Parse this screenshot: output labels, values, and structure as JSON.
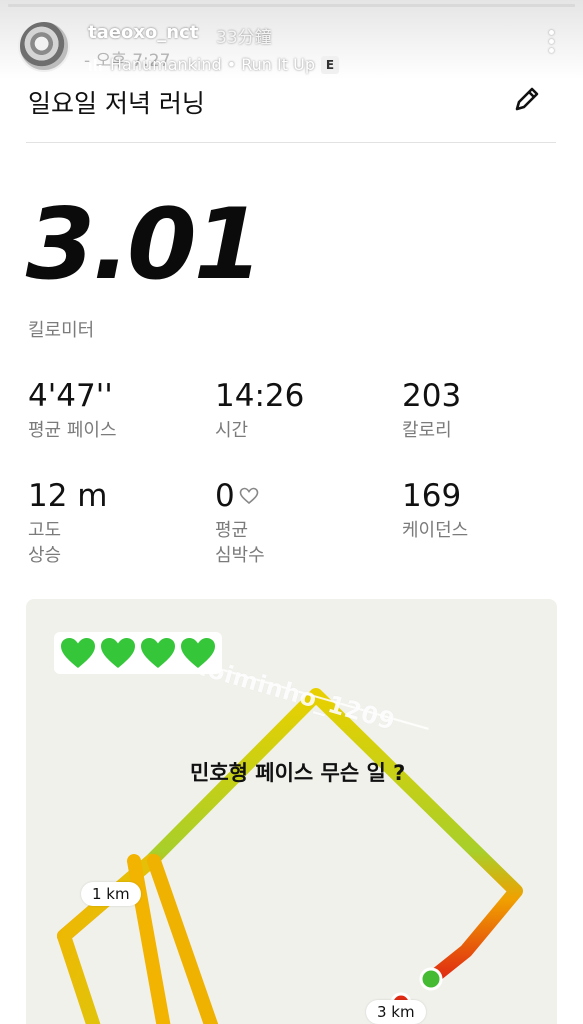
{
  "story": {
    "username": "taeoxo_nct",
    "time_ago": "33分鐘",
    "music": "Hanumankind • Run It Up",
    "explicit_badge": "E",
    "progress": 1.0
  },
  "run": {
    "date_fragment": "- 오후 7:27",
    "title": "일요일 저녁 러닝",
    "distance": "3.01",
    "distance_unit": "킬로미터",
    "stats": [
      {
        "value": "4'47''",
        "label": "평균 페이스"
      },
      {
        "value": "14:26",
        "label": "시간"
      },
      {
        "value": "203",
        "label": "칼로리"
      },
      {
        "value": "12 m",
        "label": "고도\n상승"
      },
      {
        "value": "0",
        "label": "평균\n심박수"
      },
      {
        "value": "169",
        "label": "케이던스"
      }
    ]
  },
  "map": {
    "mention": "@choiminho_1209",
    "caption": "민호형 페이스 무슨 일 ?",
    "km_markers": [
      "1 km",
      "3 km"
    ],
    "hearts_count": 4,
    "route_colors": {
      "start": "#f0c400",
      "mid": "#9ccc2a",
      "end": "#e02a12"
    }
  }
}
